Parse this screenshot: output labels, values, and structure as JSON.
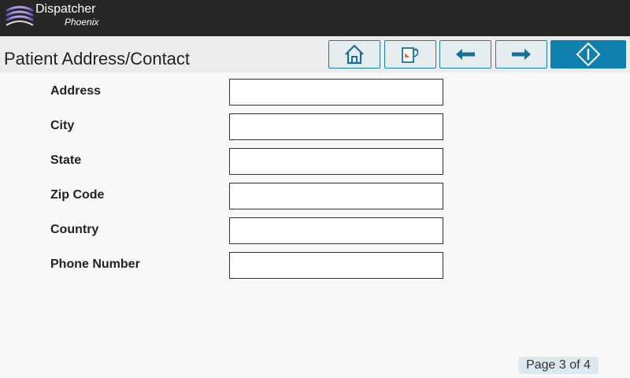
{
  "app": {
    "brand_name": "Dispatcher",
    "brand_sub": "Phoenix"
  },
  "header": {
    "title": "Patient Address/Contact"
  },
  "toolbar": {
    "buttons": [
      {
        "name": "home-button",
        "icon": "home-icon"
      },
      {
        "name": "job-return-button",
        "icon": "document-return-icon"
      },
      {
        "name": "back-button",
        "icon": "arrow-left-icon"
      },
      {
        "name": "next-button",
        "icon": "arrow-right-icon"
      },
      {
        "name": "start-button",
        "icon": "start-diamond-icon"
      }
    ],
    "accent_color": "#0f7fae"
  },
  "form": {
    "fields": [
      {
        "label": "Address",
        "value": ""
      },
      {
        "label": "City",
        "value": ""
      },
      {
        "label": "State",
        "value": ""
      },
      {
        "label": "Zip Code",
        "value": ""
      },
      {
        "label": "Country",
        "value": ""
      },
      {
        "label": "Phone Number",
        "value": ""
      }
    ]
  },
  "footer": {
    "page_indicator": "Page 3 of 4"
  }
}
